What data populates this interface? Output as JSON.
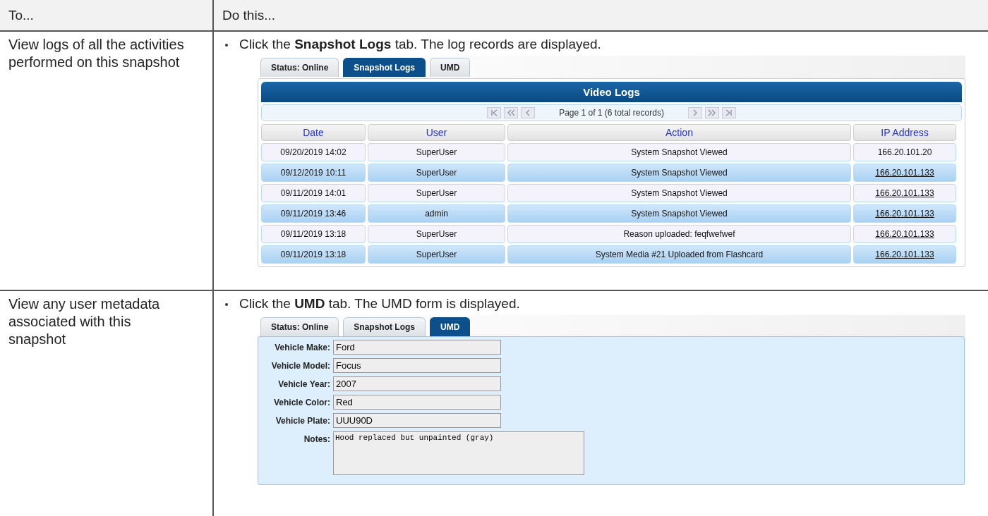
{
  "table": {
    "columns": [
      "To...",
      "Do this..."
    ],
    "rows": [
      {
        "kind": "logs",
        "task": "View logs of all the activities performed on this snapshot",
        "step": "Click the **Snapshot Logs** tab. The log records are displayed.",
        "tabs": [
          {
            "label": "Status: Online",
            "selected": false
          },
          {
            "label": "Snapshot Logs",
            "selected": true
          },
          {
            "label": "UMD",
            "selected": false
          }
        ],
        "panel_title": "Video Logs",
        "pager": "Page 1 of 1 (6 total records)",
        "log_columns": [
          "Date",
          "User",
          "Action",
          "IP Address"
        ],
        "records": [
          {
            "date": "09/20/2019 14:02",
            "user": "SuperUser",
            "action": "System Snapshot Viewed",
            "ip": "166.20.101.20",
            "link": false
          },
          {
            "date": "09/12/2019 10:11",
            "user": "SuperUser",
            "action": "System Snapshot Viewed",
            "ip": "166.20.101.133",
            "link": true
          },
          {
            "date": "09/11/2019 14:01",
            "user": "SuperUser",
            "action": "System Snapshot Viewed",
            "ip": "166.20.101.133",
            "link": true
          },
          {
            "date": "09/11/2019 13:46",
            "user": "admin",
            "action": "System Snapshot Viewed",
            "ip": "166.20.101.133",
            "link": true
          },
          {
            "date": "09/11/2019 13:18",
            "user": "SuperUser",
            "action": "Reason uploaded: feqfwefwef",
            "ip": "166.20.101.133",
            "link": true
          },
          {
            "date": "09/11/2019 13:18",
            "user": "SuperUser",
            "action": "System Media #21 Uploaded from Flashcard",
            "ip": "166.20.101.133",
            "link": true
          }
        ]
      },
      {
        "kind": "form",
        "task": "View any user metadata associated with this snapshot",
        "step": "Click the **UMD** tab. The UMD form is displayed.",
        "tabs": [
          {
            "label": "Status: Online",
            "selected": false
          },
          {
            "label": "Snapshot Logs",
            "selected": false
          },
          {
            "label": "UMD",
            "selected": true
          }
        ],
        "fields": [
          {
            "label": "Vehicle Make:",
            "value": "Ford",
            "kind": "text"
          },
          {
            "label": "Vehicle Model:",
            "value": "Focus",
            "kind": "text"
          },
          {
            "label": "Vehicle Year:",
            "value": "2007",
            "kind": "text"
          },
          {
            "label": "Vehicle Color:",
            "value": "Red",
            "kind": "text"
          },
          {
            "label": "Vehicle Plate:",
            "value": "UUU90D",
            "kind": "text"
          },
          {
            "label": "Notes:",
            "value": "Hood replaced but unpainted (gray)",
            "kind": "textarea"
          }
        ]
      }
    ]
  }
}
